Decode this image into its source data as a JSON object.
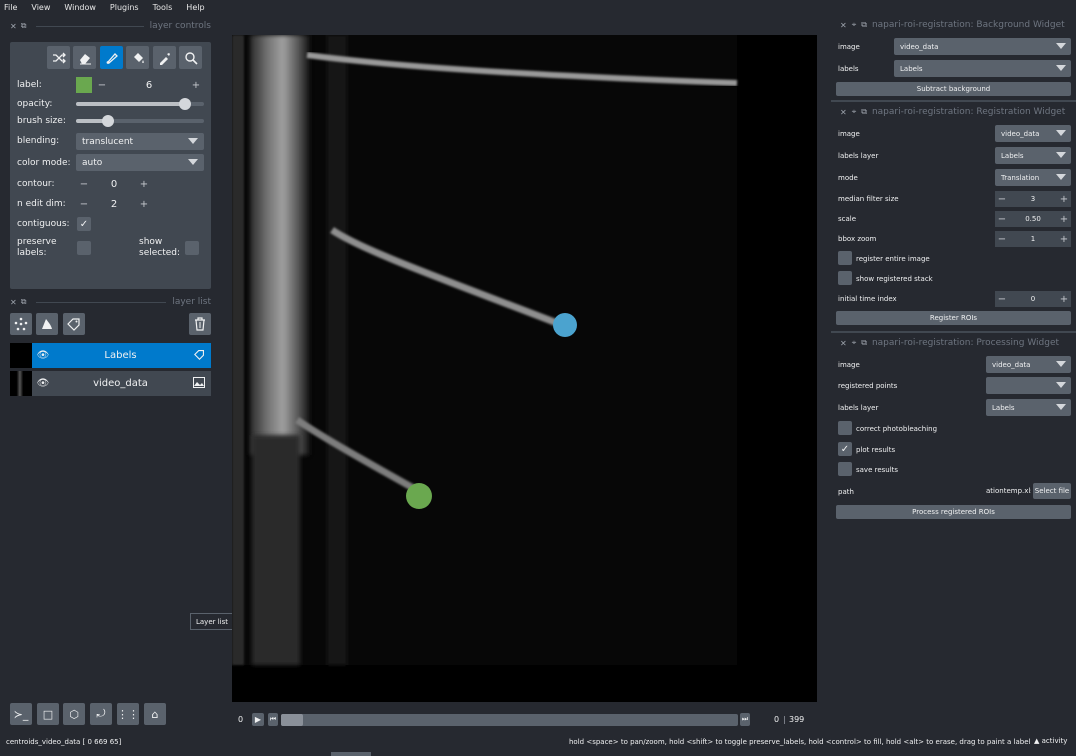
{
  "menubar": [
    "File",
    "View",
    "Window",
    "Plugins",
    "Tools",
    "Help"
  ],
  "layer_controls": {
    "title": "layer controls",
    "label_label": "label:",
    "label_value": "6",
    "label_color": "#6aa84f",
    "opacity_label": "opacity:",
    "opacity_value": 0.85,
    "brush_label": "brush size:",
    "brush_value": 0.25,
    "blending_label": "blending:",
    "blending_value": "translucent",
    "colormode_label": "color mode:",
    "colormode_value": "auto",
    "contour_label": "contour:",
    "contour_value": "0",
    "nedit_label": "n edit dim:",
    "nedit_value": "2",
    "contiguous_label": "contiguous:",
    "preserve_label": "preserve\nlabels:",
    "show_selected_label": "show\nselected:",
    "tools": [
      "shuffle-icon",
      "eraser-icon",
      "paintbrush-icon",
      "fill-bucket-icon",
      "color-picker-icon",
      "zoom-icon"
    ]
  },
  "layer_list": {
    "title": "layer list",
    "layers": [
      {
        "name": "Labels",
        "selected": true,
        "type_icon": "label-tag-icon"
      },
      {
        "name": "video_data",
        "selected": false,
        "type_icon": "image-icon"
      }
    ]
  },
  "tooltip": "Layer list",
  "dims": {
    "current": "0",
    "frame": "0",
    "max": "399"
  },
  "status": {
    "left": "centroids_video_data [  0  669  65]",
    "hint": "hold <space> to pan/zoom, hold <shift> to toggle preserve_labels, hold <control> to fill, hold <alt> to erase, drag to paint a label",
    "activity": "activity"
  },
  "background_widget": {
    "title": "napari-roi-registration: Background Widget",
    "image_label": "image",
    "image_value": "video_data",
    "labels_label": "labels",
    "labels_value": "Labels",
    "button": "Subtract background"
  },
  "registration_widget": {
    "title": "napari-roi-registration: Registration Widget",
    "image_label": "image",
    "image_value": "video_data",
    "labels_layer_label": "labels layer",
    "labels_layer_value": "Labels",
    "mode_label": "mode",
    "mode_value": "Translation",
    "median_label": "median filter size",
    "median_value": "3",
    "scale_label": "scale",
    "scale_value": "0.50",
    "bbox_label": "bbox zoom",
    "bbox_value": "1",
    "register_entire_label": "register entire image",
    "show_registered_label": "show registered stack",
    "initial_time_label": "initial time index",
    "initial_time_value": "0",
    "button": "Register ROIs"
  },
  "processing_widget": {
    "title": "napari-roi-registration: Processing Widget",
    "image_label": "image",
    "image_value": "video_data",
    "registered_points_label": "registered points",
    "registered_points_value": "",
    "labels_layer_label": "labels layer",
    "labels_layer_value": "Labels",
    "correct_label": "correct photobleaching",
    "plot_label": "plot results",
    "save_label": "save results",
    "path_label": "path",
    "path_value": "ationtemp.xls",
    "select_file": "Select file",
    "button": "Process registered ROIs"
  }
}
